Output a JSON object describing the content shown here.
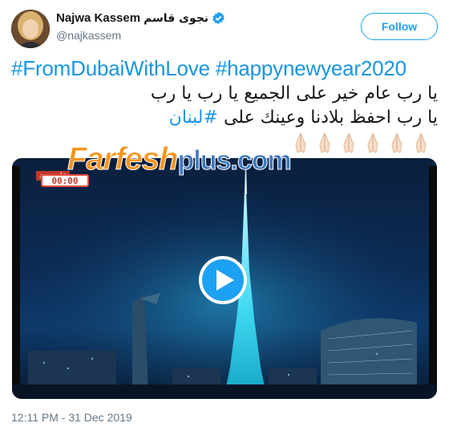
{
  "author": {
    "name": "Najwa Kassem",
    "name_arabic": "نجوى قاسم",
    "handle": "@najkassem",
    "verified": true
  },
  "follow_button": {
    "label": "Follow"
  },
  "tweet": {
    "hashtags": [
      "#FromDubaiWithLove",
      "#happynewyear2020"
    ],
    "arabic_line1": "يا رب عام خير على الجميع يا رب يا رب",
    "arabic_line2_text": "يا رب احفظ بلادنا وعينك على ",
    "arabic_line2_hashtag": "#لبنان",
    "emoji": [
      "folded-hands",
      "folded-hands",
      "folded-hands",
      "folded-hands",
      "folded-hands",
      "folded-hands"
    ]
  },
  "watermark": {
    "part1": "Farfesh",
    "part2": "plus.com"
  },
  "video": {
    "channel_label": "عام جديد",
    "timer": "00:00",
    "play_icon": "play-icon"
  },
  "timestamp": "12:11 PM - 31 Dec 2019",
  "colors": {
    "accent": "#1da1f2",
    "link": "#1b95e0",
    "muted": "#657786",
    "watermark_orange": "#f7941d",
    "watermark_blue": "#3b78c1"
  }
}
